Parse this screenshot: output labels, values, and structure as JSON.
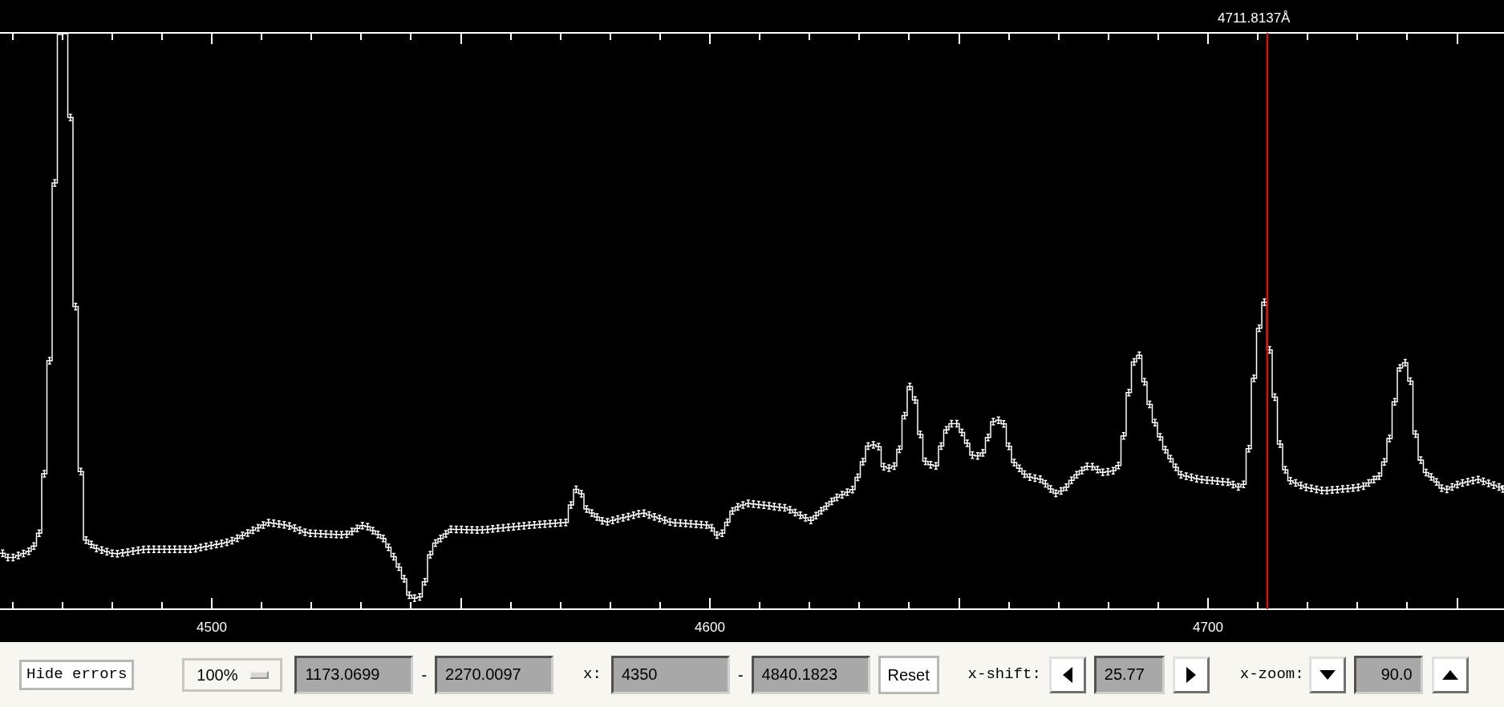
{
  "plot": {
    "cursor_label": "4711.8137Å",
    "x_tick_labels": [
      "4500",
      "4600",
      "4700"
    ]
  },
  "toolbar": {
    "errors_button": "Hide errors",
    "scale_menu": "100%",
    "y_range": {
      "from": "1173.0699",
      "separator": "-",
      "to": "2270.0097"
    },
    "x_range": {
      "label": "x:",
      "from": "4350",
      "separator": "-",
      "to": "4840.1823"
    },
    "reset_button": "Reset",
    "x_shift": {
      "label": "x-shift:",
      "value": "25.77"
    },
    "x_zoom": {
      "label": "x-zoom:",
      "value": "90.0"
    }
  }
}
